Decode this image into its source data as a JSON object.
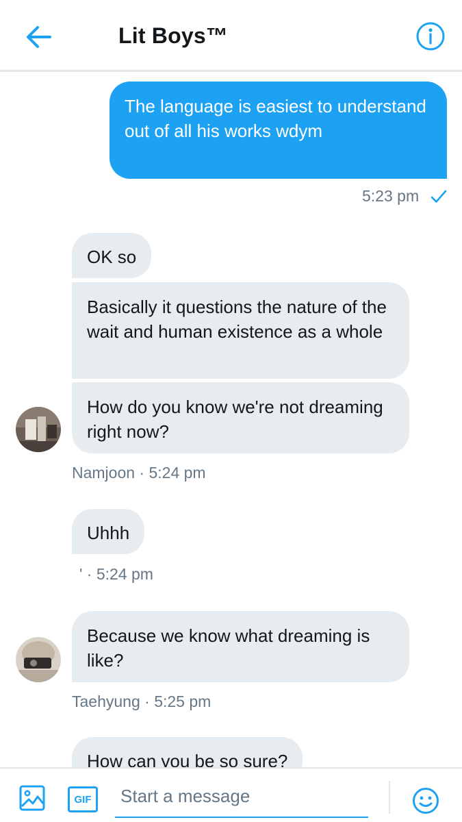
{
  "header": {
    "title": "Lit Boys™",
    "back_icon": "back-arrow-icon",
    "info_icon": "info-icon"
  },
  "colors": {
    "accent": "#1da1f2",
    "received_bubble": "#e6ecf0",
    "meta_text": "#657786",
    "primary_text": "#14171a"
  },
  "messages": [
    {
      "from": "me",
      "text": "The language is easiest to understand out of all his works wdym",
      "time": "5:23 pm",
      "status_icon": "checkmark-icon"
    },
    {
      "from": "Namjoon",
      "bubbles": [
        "OK so",
        "Basically it questions the nature of the wait and human existence as a whole",
        "How do you know we're not dreaming right now?"
      ],
      "meta": "Namjoon · 5:24 pm"
    },
    {
      "from": "'",
      "bubbles": [
        "Uhhh"
      ],
      "meta": "' · 5:24 pm"
    },
    {
      "from": "Taehyung",
      "bubbles": [
        "Because we know what dreaming is like?"
      ],
      "meta": "Taehyung · 5:25 pm"
    },
    {
      "from": "unknown",
      "bubbles": [
        "How can you be so sure?"
      ]
    }
  ],
  "composer": {
    "placeholder": "Start a message",
    "media_icon": "image-icon",
    "gif_label": "GIF",
    "emoji_icon": "emoji-icon"
  }
}
